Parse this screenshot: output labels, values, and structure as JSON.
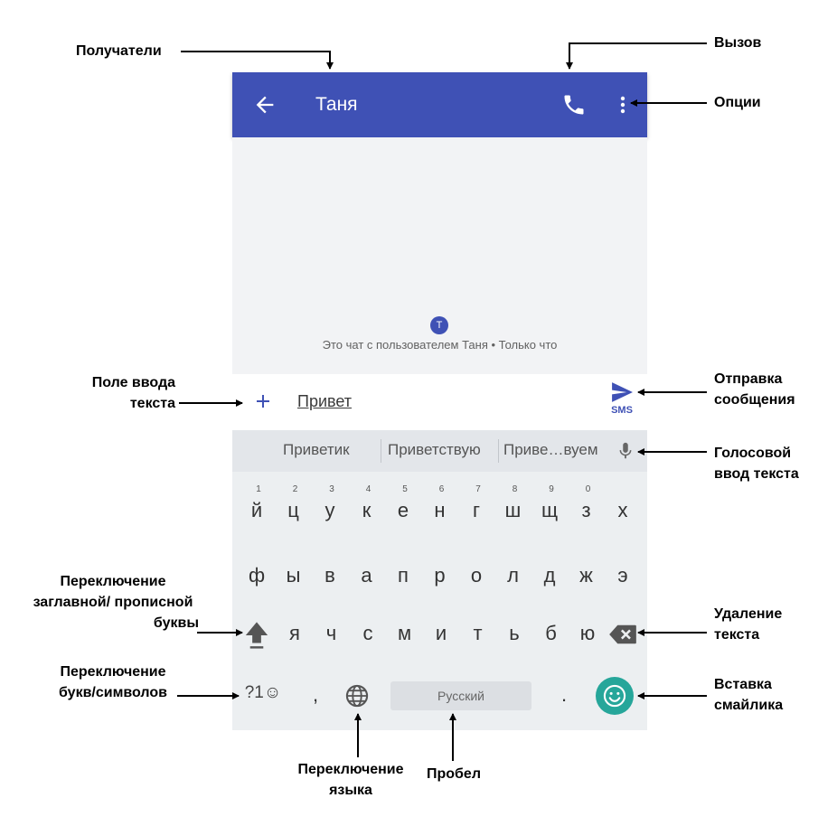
{
  "appbar": {
    "title": "Таня"
  },
  "chat": {
    "avatar_letter": "Т",
    "info": "Это чат с пользователем Таня • Только что"
  },
  "compose": {
    "text": "Привет",
    "send_label": "SMS"
  },
  "suggestions": [
    "Приветик",
    "Приветствую",
    "Приве…вуем"
  ],
  "keyboard": {
    "row1": [
      {
        "k": "й",
        "h": "1"
      },
      {
        "k": "ц",
        "h": "2"
      },
      {
        "k": "у",
        "h": "3"
      },
      {
        "k": "к",
        "h": "4"
      },
      {
        "k": "е",
        "h": "5"
      },
      {
        "k": "н",
        "h": "6"
      },
      {
        "k": "г",
        "h": "7"
      },
      {
        "k": "ш",
        "h": "8"
      },
      {
        "k": "щ",
        "h": "9"
      },
      {
        "k": "з",
        "h": "0"
      },
      {
        "k": "х",
        "h": ""
      }
    ],
    "row2": [
      "ф",
      "ы",
      "в",
      "а",
      "п",
      "р",
      "о",
      "л",
      "д",
      "ж",
      "э"
    ],
    "row3": [
      "я",
      "ч",
      "с",
      "м",
      "и",
      "т",
      "ь",
      "б",
      "ю"
    ],
    "symbols": "?1☺",
    "comma": ",",
    "period": ".",
    "space": "Русский"
  },
  "callouts": {
    "recipients": "Получатели",
    "call": "Вызов",
    "options": "Опции",
    "input_field_1": "Поле ввода",
    "input_field_2": "текста",
    "send_1": "Отправка",
    "send_2": "сообщения",
    "voice_1": "Голосовой",
    "voice_2": "ввод текста",
    "shift_1": "Переключение",
    "shift_2": "заглавной/ прописной",
    "shift_3": "буквы",
    "delete_1": "Удаление",
    "delete_2": "текста",
    "symbols_1": "Переключение",
    "symbols_2": "букв/символов",
    "emoji_1": "Вставка",
    "emoji_2": "смайлика",
    "lang_1": "Переключение",
    "lang_2": "языка",
    "space": "Пробел"
  },
  "colors": {
    "appbar": "#3f51b5",
    "emoji_button": "#26a69a"
  }
}
